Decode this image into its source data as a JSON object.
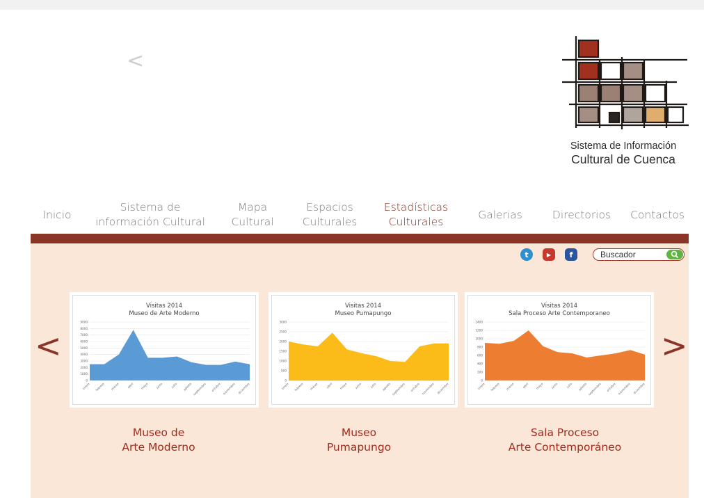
{
  "header": {
    "prev_glyph": "<",
    "logo_line1": "Sistema de Información",
    "logo_line2": "Cultural de Cuenca"
  },
  "nav": [
    {
      "line1": "Inicio",
      "line2": ""
    },
    {
      "line1": "Sistema de",
      "line2": "información Cultural"
    },
    {
      "line1": "Mapa",
      "line2": "Cultural"
    },
    {
      "line1": "Espacios",
      "line2": "Culturales"
    },
    {
      "line1": "Estadísticas",
      "line2": "Culturales"
    },
    {
      "line1": "Galerias",
      "line2": ""
    },
    {
      "line1": "Directorios",
      "line2": ""
    },
    {
      "line1": "Contactos",
      "line2": ""
    }
  ],
  "search": {
    "placeholder": "Buscador"
  },
  "social": [
    {
      "icon": "twitter-icon",
      "glyph": "t",
      "color": "#2e8fd0"
    },
    {
      "icon": "youtube-icon",
      "glyph": "▶",
      "color": "#c7392d"
    },
    {
      "icon": "facebook-icon",
      "glyph": "f",
      "color": "#2c55a0"
    }
  ],
  "carousel": {
    "prev_glyph": "<",
    "next_glyph": ">"
  },
  "colors": {
    "accent": "#8b3526",
    "content_bg": "#fbe7d8",
    "caption": "#a12b1e"
  },
  "cards": [
    {
      "caption_line1": "Museo de",
      "caption_line2": "Arte Moderno",
      "chart_data": {
        "type": "area",
        "title": "Visitas 2014",
        "subtitle": "Museo de Arte Moderno",
        "color": "#5b9bd5",
        "categories": [
          "enero",
          "febrero",
          "marzo",
          "abril",
          "mayo",
          "junio",
          "julio",
          "agosto",
          "septiembre",
          "octubre",
          "noviembre",
          "diciembre"
        ],
        "values": [
          2500,
          2500,
          4000,
          7800,
          3500,
          3500,
          3700,
          2800,
          2400,
          2400,
          2900,
          2500
        ],
        "yticks": [
          0,
          1000,
          2000,
          3000,
          4000,
          5000,
          6000,
          7000,
          8000,
          9000
        ],
        "ylim": [
          0,
          9000
        ]
      }
    },
    {
      "caption_line1": "Museo",
      "caption_line2": "Pumapungo",
      "chart_data": {
        "type": "area",
        "title": "Visitas 2014",
        "subtitle": "Museo Pumapungo",
        "color": "#fbbc1a",
        "categories": [
          "enero",
          "febrero",
          "marzo",
          "abril",
          "mayo",
          "junio",
          "julio",
          "agosto",
          "septiembre",
          "octubre",
          "noviembre",
          "diciembre"
        ],
        "values": [
          2000,
          1850,
          1750,
          2450,
          1600,
          1400,
          1250,
          1000,
          950,
          1750,
          1900,
          1900
        ],
        "yticks": [
          0,
          500,
          1000,
          1500,
          2000,
          2500,
          3000
        ],
        "ylim": [
          0,
          3000
        ]
      }
    },
    {
      "caption_line1": "Sala Proceso",
      "caption_line2": "Arte Contemporáneo",
      "chart_data": {
        "type": "area",
        "title": "Visitas 2014",
        "subtitle": "Sala Proceso Arte Contemporaneo",
        "color": "#ed7d31",
        "categories": [
          "enero",
          "febrero",
          "marzo",
          "abril",
          "mayo",
          "junio",
          "julio",
          "agosto",
          "septiembre",
          "octubre",
          "noviembre",
          "diciembre"
        ],
        "values": [
          900,
          880,
          950,
          1200,
          820,
          680,
          650,
          550,
          600,
          650,
          730,
          620
        ],
        "yticks": [
          0,
          200,
          400,
          600,
          800,
          1000,
          1200,
          1400
        ],
        "ylim": [
          0,
          1400
        ]
      }
    }
  ]
}
